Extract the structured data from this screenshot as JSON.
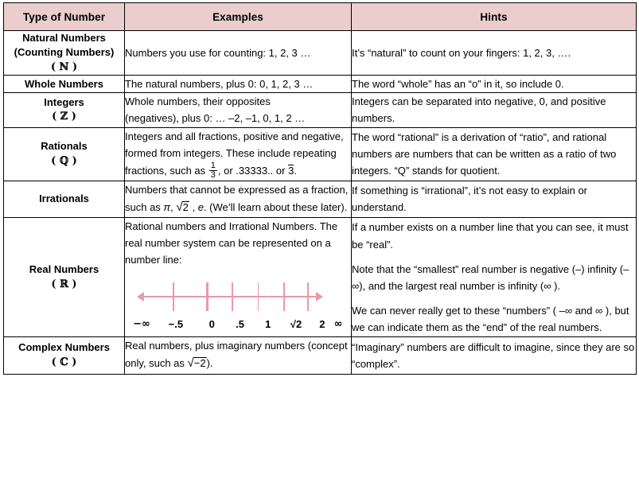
{
  "table": {
    "headers": [
      "Type of Number",
      "Examples",
      "Hints"
    ],
    "header_bg": "#ebcdcd",
    "border_color": "#000000",
    "rows": [
      {
        "type_lines": [
          "Natural Numbers",
          "(Counting Numbers)"
        ],
        "symbol": "( ℕ )",
        "example": "Numbers you use for counting: 1, 2, 3 …",
        "hint": "It’s “natural” to count on your fingers: 1, 2, 3, …."
      },
      {
        "type_lines": [
          "Whole Numbers"
        ],
        "symbol": "",
        "example": "The natural numbers, plus 0: 0, 1, 2, 3 …",
        "hint": "The word “whole” has an “o” in it, so include 0."
      },
      {
        "type_lines": [
          "Integers"
        ],
        "symbol": "( ℤ )",
        "example_lines": [
          "Whole numbers, their opposites",
          "(negatives), plus 0: … –2, –1, 0, 1, 2 …"
        ],
        "hint": "Integers can be separated into negative, 0, and positive numbers."
      },
      {
        "type_lines": [
          "Rationals"
        ],
        "symbol": "( ℚ )",
        "example_parts": {
          "before_fraction": "Integers and all fractions, positive and negative, formed from integers.  These include repeating fractions, such as ",
          "fraction_num": "1",
          "fraction_den": "3",
          "after_fraction": ", or .33333.. or ",
          "repeating": "3",
          "end": "."
        },
        "hint": "The word “rational” is a derivation of “ratio”, and rational numbers are numbers that can be written as a ratio of two integers.  “Q” stands for quotient."
      },
      {
        "type_lines": [
          "Irrationals"
        ],
        "symbol": "",
        "example_parts": {
          "before": "Numbers that cannot be expressed as a fraction, such as ",
          "pi": "π",
          "mid1": ", ",
          "sqrt_radicand": "2",
          "mid2": " , ",
          "e": "e",
          "after": ". (We’ll learn about these later)."
        },
        "hint": "If something is “irrational”, it’s not easy to explain or understand."
      },
      {
        "type_lines": [
          "Real Numbers"
        ],
        "symbol": "( ℝ )",
        "example_intro": "Rational numbers and Irrational Numbers.  The real number system can be represented on a number line:",
        "number_line": {
          "labels": [
            "−∞",
            "−.5",
            "0",
            ".5",
            "1",
            "√2",
            "2",
            "∞"
          ],
          "label_positions_pct": [
            2,
            19,
            37,
            51,
            65,
            79,
            92,
            100
          ],
          "tick_positions_pct": [
            19,
            37,
            51,
            65,
            79,
            92
          ],
          "major_tick_index": 1,
          "axis_color": "#e899a8",
          "left_arrow": true,
          "right_arrow": true
        },
        "hint_paragraphs": [
          "If a number exists on a number line that you can see, it must be “real”.",
          "Note that the “smallest” real number is negative (–) infinity (–∞), and the largest real number is infinity  (∞ ).",
          "We can never really get to these “numbers” ( –∞ and ∞ ), but we can indicate them as the “end” of the real numbers."
        ]
      },
      {
        "type_lines": [
          "Complex Numbers"
        ],
        "symbol": "( ℂ )",
        "example_parts": {
          "before": "Real numbers, plus imaginary numbers (concept only, such as ",
          "sqrt_radicand": "−2",
          "after": ")."
        },
        "hint": "“Imaginary” numbers are difficult to imagine, since they are so “complex”."
      }
    ]
  }
}
